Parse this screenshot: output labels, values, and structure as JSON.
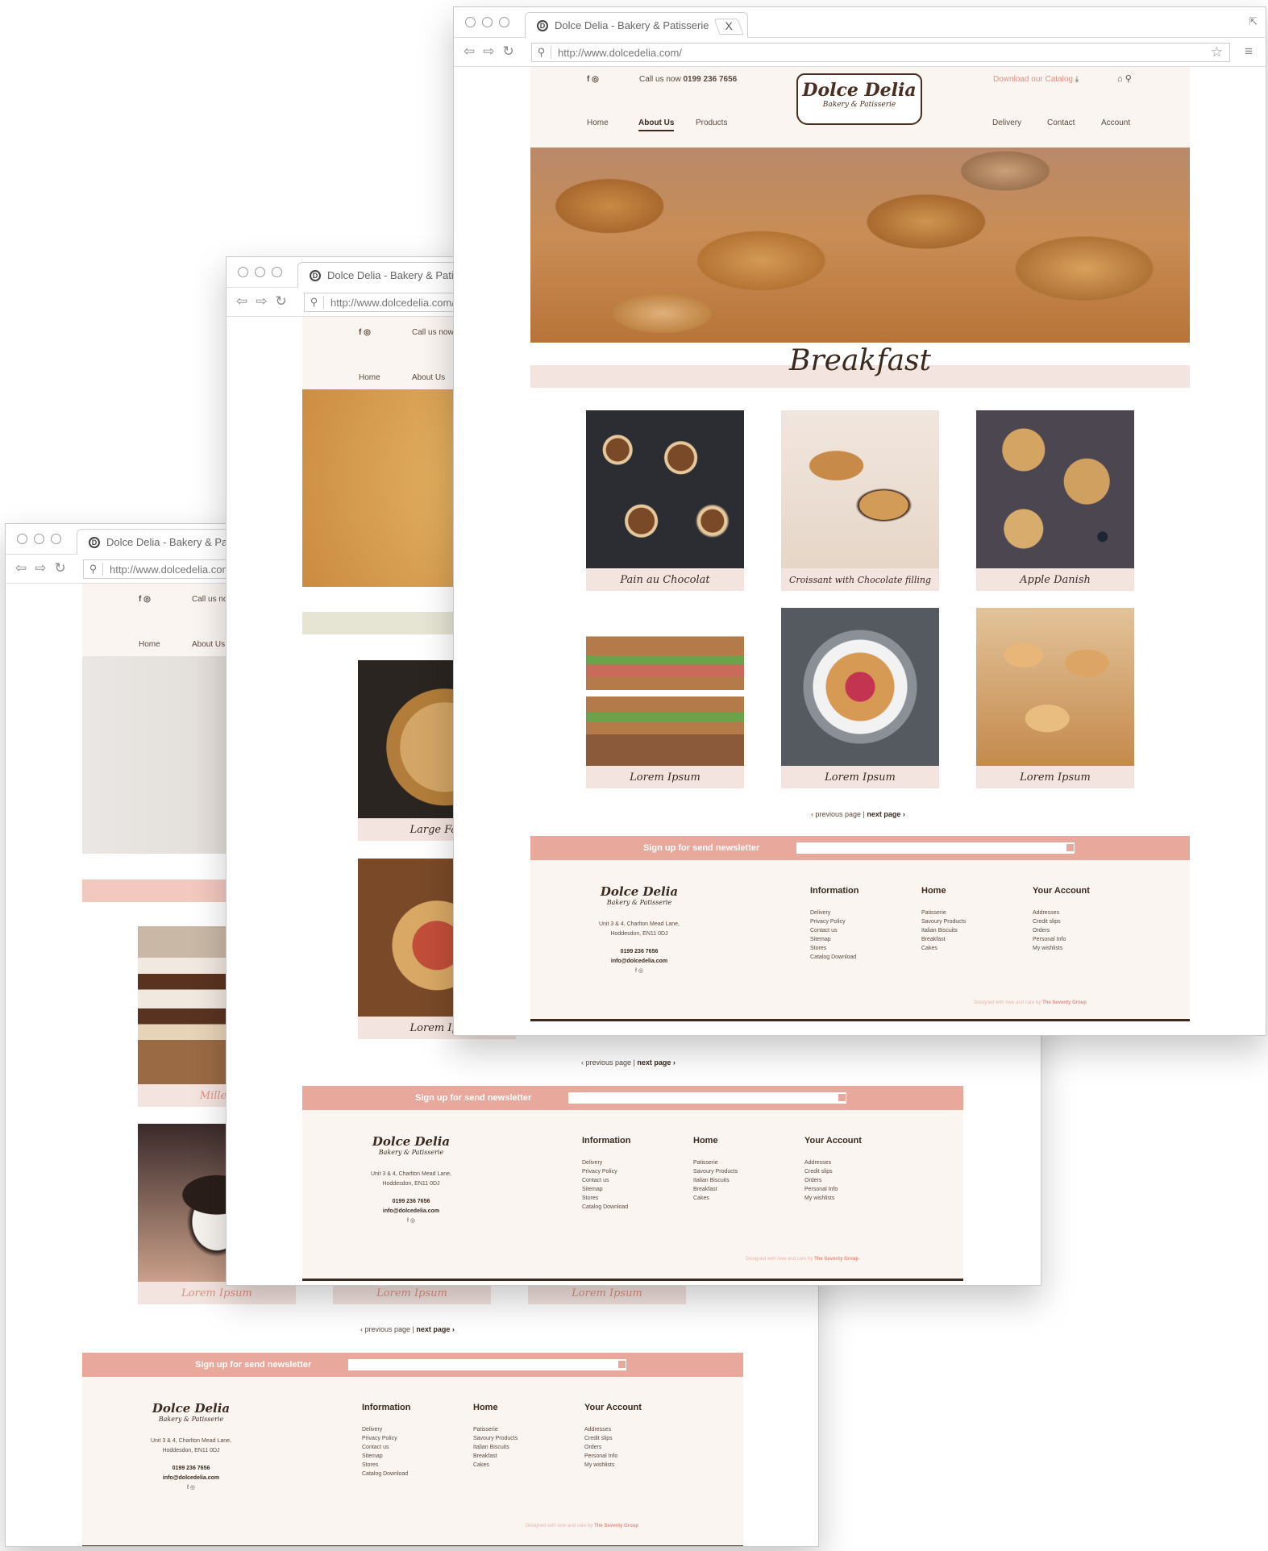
{
  "browser": {
    "tab_title": "Dolce Delia - Bakery & Patisserie",
    "tab_title_cut_mid": "Dolce Delia - Bakery & Patisser",
    "tab_title_cut_back": "Dolce Delia - Bakery & Patiss",
    "close": "X",
    "url": "http://www.dolcedelia.com/",
    "url_cut_mid": "http://www.dolcedelia.com/",
    "url_cut_back": "http://www.dolcedelia.com"
  },
  "header": {
    "social": "f ◎",
    "call_label": "Call us now",
    "call_cut": "Call us no",
    "call_cut_mid": "Call us now",
    "phone": "0199 236 7656",
    "catalog": "Download our Catalog",
    "cart_search": "⌂ ⚲",
    "logo_name": "Dolce Delia",
    "logo_tag": "Bakery & Patisserie"
  },
  "nav": {
    "home": "Home",
    "about": "About Us",
    "products": "Products",
    "delivery": "Delivery",
    "contact": "Contact",
    "account": "Account"
  },
  "main": {
    "section_title": "Breakfast",
    "products": [
      {
        "label": "Pain au Chocolat"
      },
      {
        "label": "Croissant with Chocolate filling"
      },
      {
        "label": "Apple Danish"
      },
      {
        "label": "Lorem Ipsum"
      },
      {
        "label": "Lorem Ipsum"
      },
      {
        "label": "Lorem Ipsum"
      }
    ],
    "mid_products": [
      {
        "label": "Large Fag"
      },
      {
        "label": "Lorem Ips"
      }
    ],
    "back_products": [
      {
        "label": "Mille f"
      },
      {
        "label": "Lorem Ipsum"
      },
      {
        "label": "Lorem Ipsum"
      },
      {
        "label": "Lorem Ipsum"
      }
    ],
    "pager_prev": "‹  previous page  |",
    "pager_next": "next page  ›"
  },
  "newsletter": {
    "label": "Sign up for send newsletter"
  },
  "footer": {
    "logo_name": "Dolce Delia",
    "logo_tag": "Bakery & Patisserie",
    "address1": "Unit 3 & 4, Charlton Mead Lane,",
    "address2": "Hoddesdon, EN11 0DJ",
    "phone": "0199 236 7656",
    "email": "info@dolcedelia.com",
    "social": "f ◎",
    "info_head": "Information",
    "info_items": [
      "Delivery",
      "Privacy Policy",
      "Contact us",
      "Sitemap",
      "Stores",
      "Catalog Download"
    ],
    "home_head": "Home",
    "home_items": [
      "Patisserie",
      "Savoury Products",
      "Italian Biscuits",
      "Breakfast",
      "Cakes"
    ],
    "account_head": "Your Account",
    "account_items": [
      "Addresses",
      "Credit slips",
      "Orders",
      "Personal Info",
      "My wishlists"
    ],
    "credit": "Designed with love and care by",
    "credit_brand": "The Seventy Group"
  },
  "colors": {
    "accent_pink": "#e9a89c",
    "site_bg": "#faf5f1",
    "brown": "#3a2a20"
  }
}
